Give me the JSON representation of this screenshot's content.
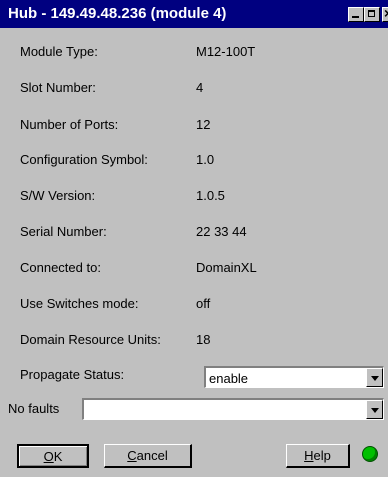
{
  "window": {
    "title": "Hub - 149.49.48.236 (module 4)",
    "close_glyph": "×"
  },
  "fields": [
    {
      "label": "Module Type:",
      "value": "M12-100T"
    },
    {
      "label": "Slot Number:",
      "value": "4"
    },
    {
      "label": "Number of Ports:",
      "value": "12"
    },
    {
      "label": "Configuration Symbol:",
      "value": "1.0"
    },
    {
      "label": "S/W Version:",
      "value": "1.0.5"
    },
    {
      "label": "Serial Number:",
      "value": "22 33 44"
    },
    {
      "label": "Connected to:",
      "value": "DomainXL"
    },
    {
      "label": "Use Switches mode:",
      "value": "off"
    },
    {
      "label": "Domain Resource Units:",
      "value": "18"
    }
  ],
  "propagate": {
    "label": "Propagate Status:",
    "value": "enable"
  },
  "faults": {
    "label": "No faults",
    "value": ""
  },
  "buttons": {
    "ok": {
      "mnemonic": "O",
      "rest": "K"
    },
    "cancel": {
      "mnemonic": "C",
      "rest": "ancel"
    },
    "help": {
      "mnemonic": "H",
      "rest": "elp"
    }
  },
  "status": {
    "color": "#00c000",
    "icon": "status-led-icon"
  }
}
